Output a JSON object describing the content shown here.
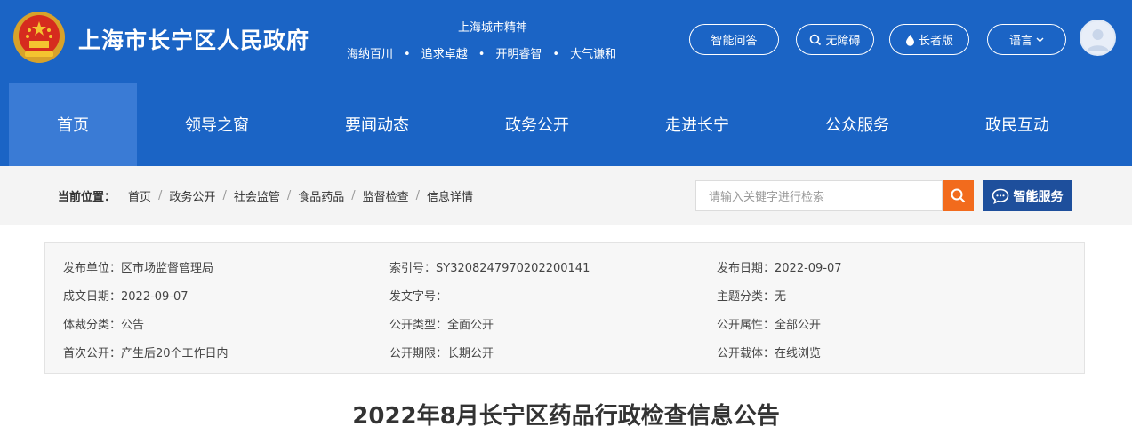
{
  "header": {
    "site_title": "上海市长宁区人民政府",
    "spirit_title": "上海城市精神",
    "spirit_items": [
      "海纳百川",
      "追求卓越",
      "开明睿智",
      "大气谦和"
    ],
    "buttons": {
      "ai": "智能问答",
      "accessibility": "无障碍",
      "elder": "长者版",
      "language": "语言"
    },
    "colors": {
      "primary": "#1b64c5",
      "nav_active": "#3a7bd5"
    }
  },
  "nav": {
    "items": [
      "首页",
      "领导之窗",
      "要闻动态",
      "政务公开",
      "走进长宁",
      "公众服务",
      "政民互动"
    ],
    "active": "首页"
  },
  "breadcrumb": {
    "label": "当前位置：",
    "items": [
      "首页",
      "政务公开",
      "社会监管",
      "食品药品",
      "监督检查",
      "信息详情"
    ]
  },
  "search": {
    "placeholder": "请输入关键字进行检索",
    "button_color": "#f26b1d"
  },
  "smart_service": {
    "label": "智能服务"
  },
  "info": {
    "publisher": "发布单位：区市场监督管理局",
    "index_no": "索引号：SY3208247970202200141",
    "publish_date": "发布日期：2022-09-07",
    "written_date": "成文日期：2022-09-07",
    "doc_no": "发文字号：",
    "topic": "主题分类：无",
    "genre": "体裁分类：公告",
    "open_type": "公开类型：全面公开",
    "open_attr": "公开属性：全部公开",
    "first_open": "首次公开：产生后20个工作日内",
    "open_period": "公开期限：长期公开",
    "open_medium": "公开载体：在线浏览"
  },
  "document": {
    "title": "2022年8月长宁区药品行政检查信息公告"
  }
}
